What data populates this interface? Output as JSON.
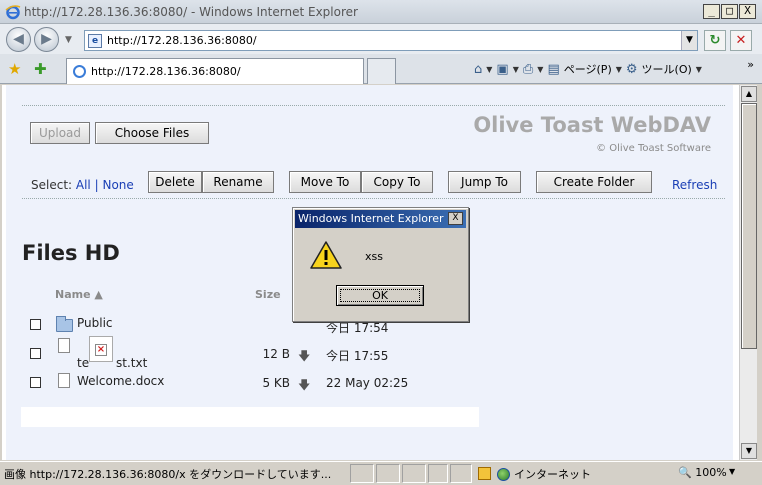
{
  "window": {
    "title": "http://172.28.136.36:8080/ - Windows Internet Explorer",
    "minimize": "_",
    "maximize": "□",
    "close": "X"
  },
  "address_bar": {
    "url": "http://172.28.136.36:8080/",
    "back_icon": "back-arrow-icon",
    "forward_icon": "forward-arrow-icon"
  },
  "tab": {
    "label": "http://172.28.136.36:8080/"
  },
  "command_bar": {
    "page_label": "ページ(P)",
    "tools_label": "ツール(O)",
    "more": "»"
  },
  "app": {
    "brand": "Olive Toast WebDAV",
    "copyright": "© Olive Toast Software",
    "upload_button": "Upload",
    "choose_files_button": "Choose Files",
    "select_label": "Select:",
    "select_all": "All",
    "select_separator": "|",
    "select_none": "None",
    "delete_button": "Delete",
    "rename_button": "Rename",
    "move_to_button": "Move To",
    "copy_to_button": "Copy To",
    "jump_to_button": "Jump To",
    "create_folder_button": "Create Folder",
    "refresh_link": "Refresh",
    "files_title": "Files HD",
    "columns": {
      "name": "Name ▲",
      "size": "Size"
    },
    "files": [
      {
        "name": "Public",
        "type": "folder",
        "size": "",
        "date": "今日 17:54"
      },
      {
        "name_prefix": "te",
        "name_suffix": "st.txt",
        "type": "file",
        "size": "12 B",
        "date": "今日 17:55"
      },
      {
        "name": "Welcome.docx",
        "type": "file",
        "size": "5 KB",
        "date": "22 May 02:25"
      }
    ],
    "download_icon": "download-arrow-icon"
  },
  "dialog": {
    "title": "Windows Internet Explorer",
    "message": "xss",
    "ok_button": "OK",
    "close": "X"
  },
  "statusbar": {
    "text": "画像 http://172.28.136.36:8080/x をダウンロードしています...",
    "zone": "インターネット",
    "zoom": "100%"
  }
}
